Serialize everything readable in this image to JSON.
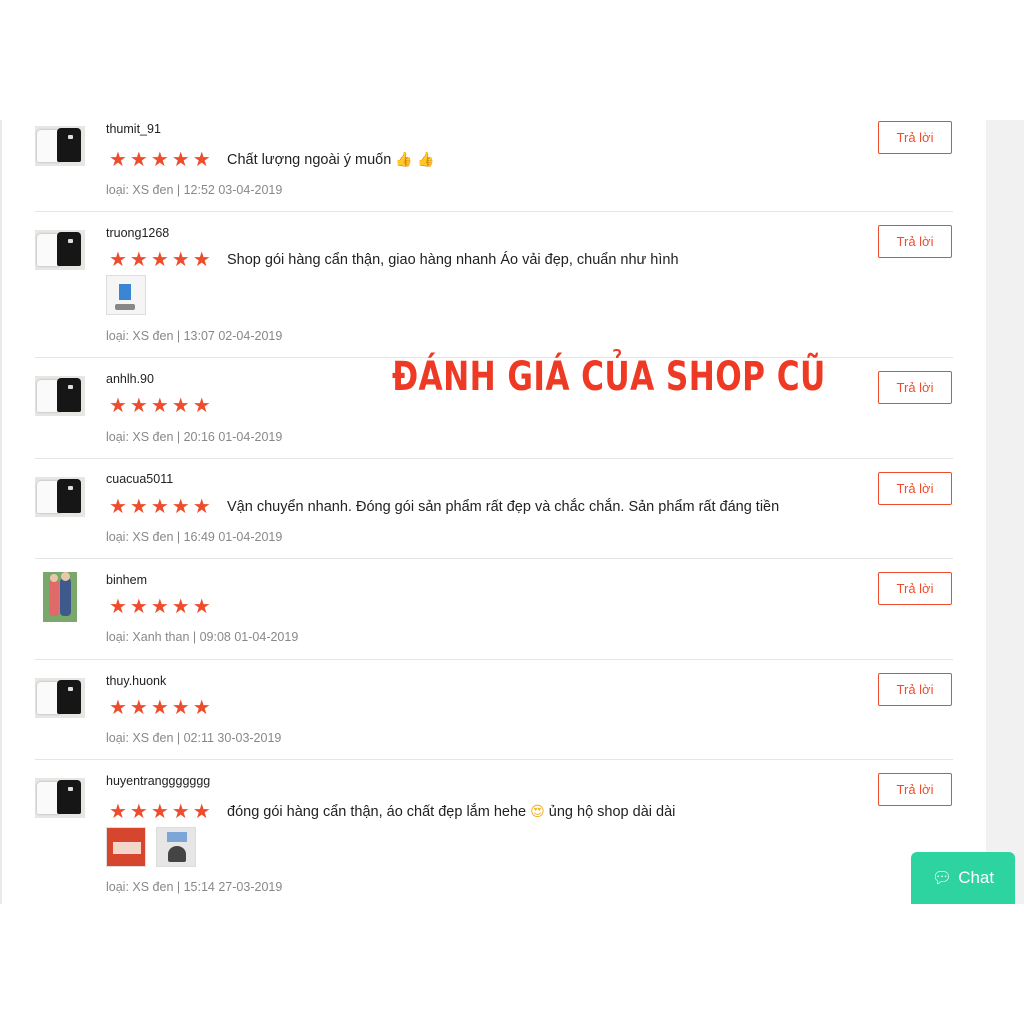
{
  "watermark": "ĐÁNH GIÁ CỦA SHOP CŨ",
  "reply_label": "Trả lời",
  "chat_label": "Chat",
  "star_glyphs": "★★★★★",
  "reviews": [
    {
      "username": "thumit_91",
      "rating": 5,
      "comment": "Chất lượng ngoài ý muốn",
      "emoji": "👍 👍",
      "meta": "loại: XS đen | 12:52 03-04-2019"
    },
    {
      "username": "truong1268",
      "rating": 5,
      "comment": "Shop gói hàng cẩn thận, giao hàng nhanh Áo vải đẹp, chuẩn như hình",
      "meta": "loại: XS đen | 13:07 02-04-2019"
    },
    {
      "username": "anhlh.90",
      "rating": 5,
      "comment": "",
      "meta": "loại: XS đen | 20:16 01-04-2019"
    },
    {
      "username": "cuacua5011",
      "rating": 5,
      "comment": "Vận chuyển nhanh. Đóng gói sản phẩm rất đẹp và chắc chắn. Sản phẩm rất đáng tiền",
      "meta": "loại: XS đen | 16:49 01-04-2019"
    },
    {
      "username": "binhem",
      "rating": 5,
      "comment": "",
      "meta": "loại: Xanh than | 09:08 01-04-2019"
    },
    {
      "username": "thuy.huonk",
      "rating": 5,
      "comment": "",
      "meta": "loại: XS đen | 02:11 30-03-2019"
    },
    {
      "username": "huyentranggggggg",
      "rating": 5,
      "comment": "đóng gói hàng cẩn thận, áo chất đẹp lắm hehe",
      "emoji": "😍",
      "comment_tail": "ủng hộ shop dài dài",
      "meta": "loại: XS đen | 15:14 27-03-2019"
    }
  ],
  "colors": {
    "accent": "#ee4d2d",
    "chat": "#2ed4a0"
  }
}
